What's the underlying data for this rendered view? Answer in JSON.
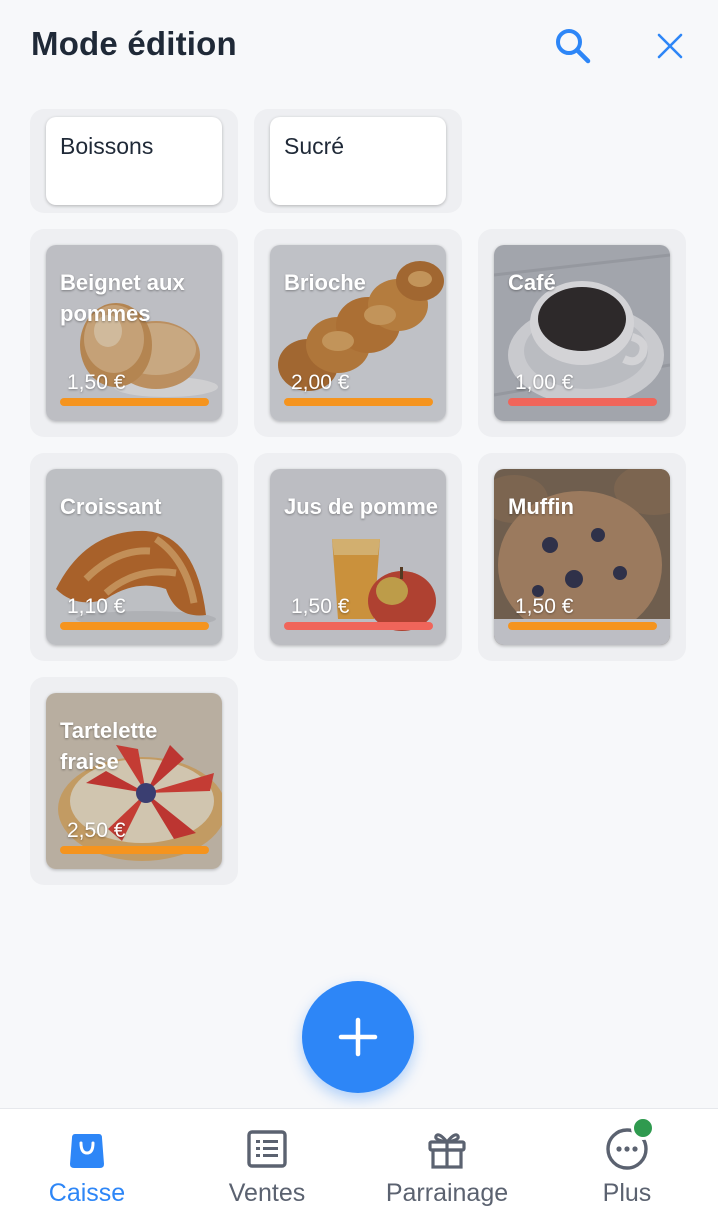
{
  "header": {
    "title": "Mode édition",
    "search_icon": "search-icon",
    "close_icon": "close-icon",
    "accent_color": "#2d86f7"
  },
  "categories": [
    {
      "label": "Boissons"
    },
    {
      "label": "Sucré"
    }
  ],
  "products": [
    {
      "name": "Beignet aux pommes",
      "price": "1,50 €",
      "bar_color": "#f5941e"
    },
    {
      "name": "Brioche",
      "price": "2,00 €",
      "bar_color": "#f5941e"
    },
    {
      "name": "Café",
      "price": "1,00 €",
      "bar_color": "#f0655a"
    },
    {
      "name": "Croissant",
      "price": "1,10 €",
      "bar_color": "#f5941e"
    },
    {
      "name": "Jus de pomme",
      "price": "1,50 €",
      "bar_color": "#f0655a"
    },
    {
      "name": "Muffin",
      "price": "1,50 €",
      "bar_color": "#f5941e"
    },
    {
      "name": "Tartelette fraise",
      "price": "2,50 €",
      "bar_color": "#f5941e"
    }
  ],
  "fab": {
    "icon": "plus-icon"
  },
  "nav": {
    "items": [
      {
        "label": "Caisse",
        "icon": "shopping-bag-icon",
        "active": true
      },
      {
        "label": "Ventes",
        "icon": "receipt-list-icon",
        "active": false
      },
      {
        "label": "Parrainage",
        "icon": "gift-icon",
        "active": false
      },
      {
        "label": "Plus",
        "icon": "more-dots-icon",
        "active": false
      }
    ],
    "notification_color": "#2f9a4f"
  }
}
